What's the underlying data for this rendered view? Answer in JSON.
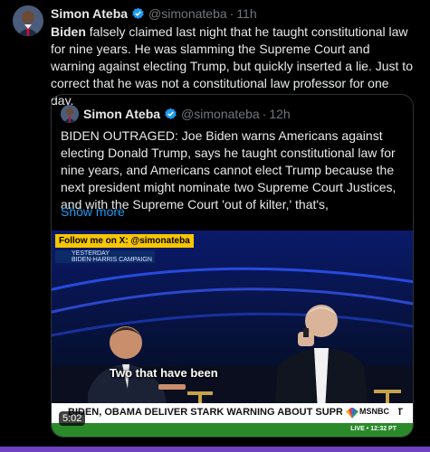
{
  "tweet": {
    "author_name": "Simon Ateba",
    "handle": "@simonateba",
    "separator": "·",
    "time": "11h",
    "text_bold": "Biden",
    "text_rest": " falsely claimed last night that he taught constitutional law for nine years. He was slamming the Supreme Court and warning against electing Trump, but quickly inserted a lie. Just to correct that he was not a constitutional law professor for one day."
  },
  "quote": {
    "author_name": "Simon Ateba",
    "handle": "@simonateba",
    "separator": "·",
    "time": "12h",
    "text": "BIDEN OUTRAGED: Joe Biden warns Americans against electing Donald Trump, says he taught constitutional law for nine years, and Americans cannot elect Trump because the next president might nominate two Supreme Court Justices, and with the Supreme Court 'out of kilter,' that's,",
    "show_more": "Show more"
  },
  "video": {
    "follow_label": "Follow me on X: @simonateba",
    "campaign_label_1": "YESTERDAY",
    "campaign_label_2": "BIDEN-HARRIS CAMPAIGN",
    "caption": "Two that have been",
    "headline": "BIDEN, OBAMA DELIVER STARK WARNING ABOUT SUPREME COURT",
    "network": "MSNBC",
    "live_label": "LIVE • 12:32 PT",
    "duration": "5:02"
  },
  "colors": {
    "background": "#000000",
    "link": "#1d9bf0",
    "verified": "#1d9bf0",
    "muted": "#71767b",
    "accent_line": "#6f42c1"
  }
}
